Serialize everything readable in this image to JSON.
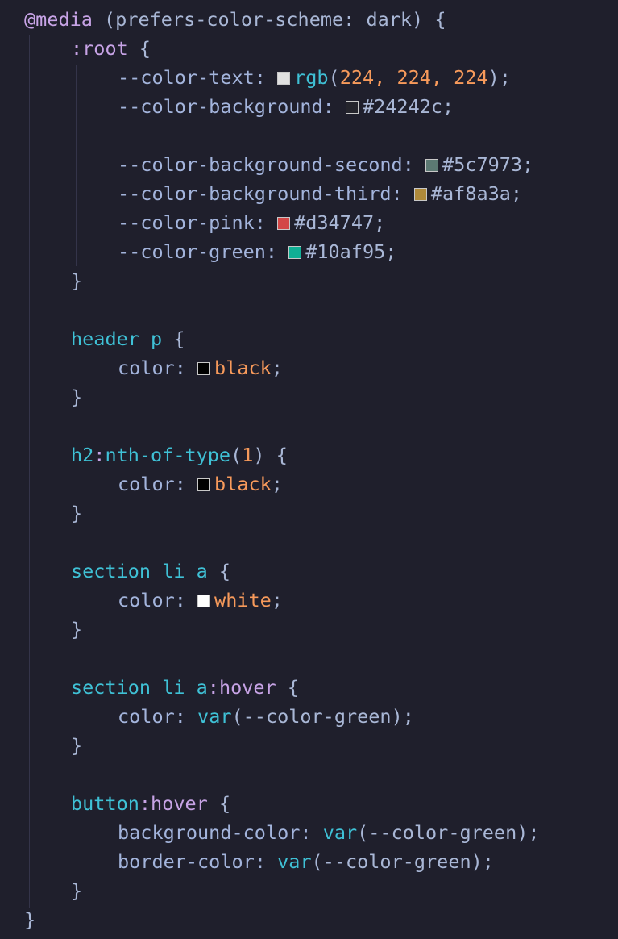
{
  "code": {
    "media_keyword": "@media",
    "media_query": " (prefers-color-scheme: dark) {",
    "root_colon": ":",
    "root_name": "root",
    "open_brace": " {",
    "close_brace": "}",
    "vars": [
      {
        "name": "--color-text:",
        "swatch": "#e0e0e0",
        "value_fn": "rgb",
        "value_paren_open": "(",
        "value_args": "224, 224, 224",
        "value_paren_close": ");"
      },
      {
        "name": "--color-background:",
        "swatch": "#24242c",
        "value": "#24242c;"
      },
      {
        "name": "--color-background-second:",
        "swatch": "#5c7973",
        "value": "#5c7973;"
      },
      {
        "name": "--color-background-third:",
        "swatch": "#af8a3a",
        "value": "#af8a3a;"
      },
      {
        "name": "--color-pink:",
        "swatch": "#d34747",
        "value": "#d34747;"
      },
      {
        "name": "--color-green:",
        "swatch": "#10af95",
        "value": "#10af95;"
      }
    ],
    "rules": [
      {
        "selector": "header p",
        "prop": "color:",
        "swatch": "#000000",
        "value": "black",
        "semi": ";"
      },
      {
        "selector_el": "h2",
        "selector_colon": ":",
        "selector_pseudo": "nth-of-type",
        "selector_paren_open": "(",
        "selector_arg": "1",
        "selector_paren_close": ")",
        "prop": "color:",
        "swatch": "#000000",
        "value": "black",
        "semi": ";"
      },
      {
        "selector": "section li a",
        "prop": "color:",
        "swatch": "#ffffff",
        "value": "white",
        "semi": ";"
      },
      {
        "selector_el": "section li a",
        "selector_colon": ":",
        "selector_pseudo": "hover",
        "prop": "color:",
        "fn": "var",
        "fn_args": "(--color-green);"
      },
      {
        "selector_el": "button",
        "selector_colon": ":",
        "selector_pseudo": "hover",
        "props": [
          {
            "prop": "background-color:",
            "fn": "var",
            "fn_args": "(--color-green);"
          },
          {
            "prop": "border-color:",
            "fn": "var",
            "fn_args": "(--color-green);"
          }
        ]
      }
    ]
  }
}
